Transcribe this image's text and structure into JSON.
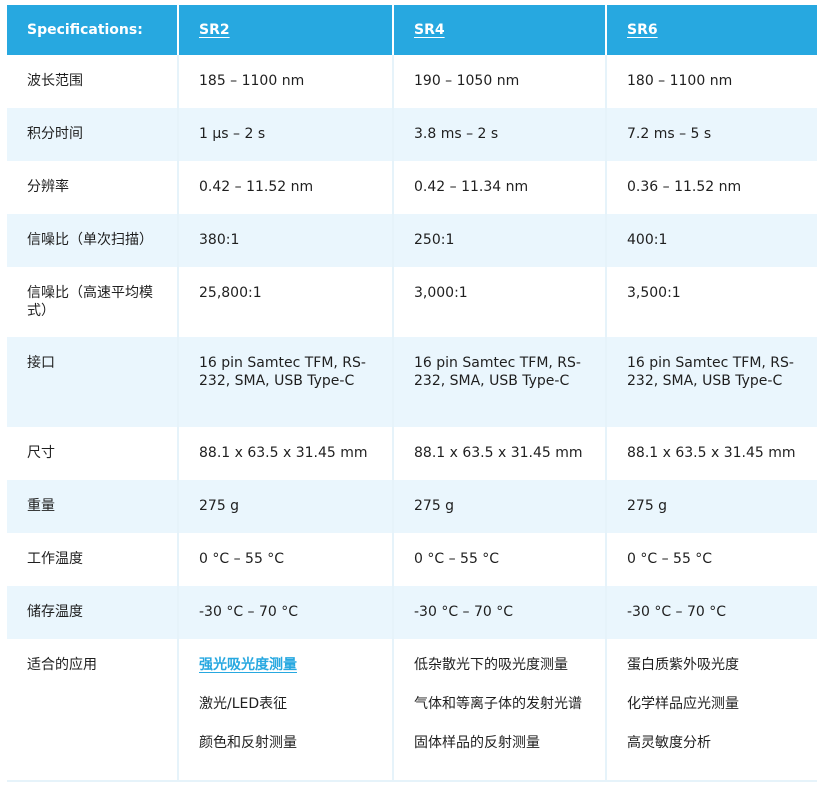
{
  "header": {
    "label": "Specifications:",
    "models": [
      "SR2",
      "SR4",
      "SR6"
    ]
  },
  "rows": [
    {
      "label": "波长范围",
      "values": [
        "185 – 1100 nm",
        "190 – 1050 nm",
        "180 – 1100 nm"
      ]
    },
    {
      "label": "积分时间",
      "values": [
        "1 µs – 2 s",
        "3.8 ms – 2 s",
        "7.2 ms – 5 s"
      ]
    },
    {
      "label": "分辨率",
      "values": [
        "0.42 – 11.52 nm",
        "0.42 – 11.34 nm",
        "0.36 – 11.52 nm"
      ]
    },
    {
      "label": "信噪比（单次扫描）",
      "values": [
        "380:1",
        "250:1",
        "400:1"
      ]
    },
    {
      "label": "信噪比（高速平均模式）",
      "values": [
        "25,800:1",
        "3,000:1",
        "3,500:1"
      ]
    },
    {
      "label": "接口",
      "values": [
        "16 pin Samtec TFM, RS-232, SMA, USB Type-C",
        "16 pin Samtec TFM, RS-232, SMA, USB Type-C",
        "16 pin Samtec TFM, RS-232, SMA, USB Type-C"
      ]
    },
    {
      "label": "尺寸",
      "values": [
        "88.1 x 63.5 x 31.45 mm",
        "88.1 x 63.5 x 31.45 mm",
        "88.1 x 63.5 x 31.45 mm"
      ]
    },
    {
      "label": "重量",
      "values": [
        "275 g",
        "275 g",
        "275 g"
      ]
    },
    {
      "label": "工作温度",
      "values": [
        "0 °C – 55 °C",
        "0 °C – 55 °C",
        "0 °C – 55 °C"
      ]
    },
    {
      "label": "储存温度",
      "values": [
        "-30 °C – 70 °C",
        "-30 °C – 70 °C",
        "-30 °C – 70 °C"
      ]
    }
  ],
  "applications": {
    "label": "适合的应用",
    "columns": [
      [
        "强光吸光度测量",
        "激光/LED表征",
        "颜色和反射测量"
      ],
      [
        "低杂散光下的吸光度测量",
        "气体和等离子体的发射光谱",
        "固体样品的反射测量"
      ],
      [
        "蛋白质紫外吸光度",
        "化学样品应光测量",
        "高灵敏度分析"
      ]
    ]
  },
  "colors": {
    "header_bg": "#27a8e0",
    "stripe_bg": "#eaf6fd",
    "link": "#27a8e0"
  }
}
